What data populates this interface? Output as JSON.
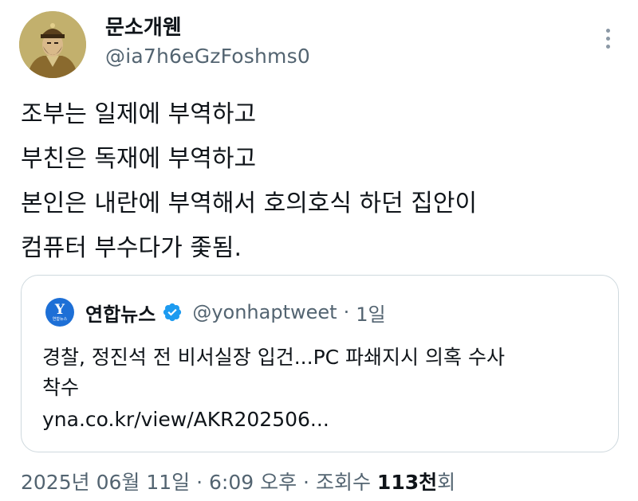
{
  "author": {
    "name": "문소개웬",
    "handle": "@ia7h6eGzFoshms0"
  },
  "tweet": {
    "lines": [
      "조부는 일제에 부역하고",
      "부친은 독재에 부역하고",
      "본인은 내란에 부역해서 호의호식 하던 집안이",
      "컴퓨터 부수다가 좇됨."
    ]
  },
  "quote": {
    "avatar_label": "연합뉴스",
    "name": "연합뉴스",
    "handle": "@yonhaptweet",
    "separator": "·",
    "time": "1일",
    "text_lines": [
      "경찰, 정진석 전 비서실장 입건...PC 파쇄지시 의혹 수사",
      "착수"
    ],
    "link": "yna.co.kr/view/AKR202506..."
  },
  "meta": {
    "date": "2025년 06월 11일",
    "sep1": "·",
    "time": "6:09 오후",
    "sep2": "·",
    "views_label": "조회수",
    "views_count": "113천",
    "views_suffix": "회"
  },
  "icons": {
    "more": "more-vertical-icon",
    "verified": "verified-badge-icon"
  },
  "colors": {
    "primary_text": "#0f1419",
    "secondary_text": "#536471",
    "border": "#cfd9de",
    "verified_blue": "#1d9bf0",
    "yonhap_blue": "#1d6fd6"
  }
}
